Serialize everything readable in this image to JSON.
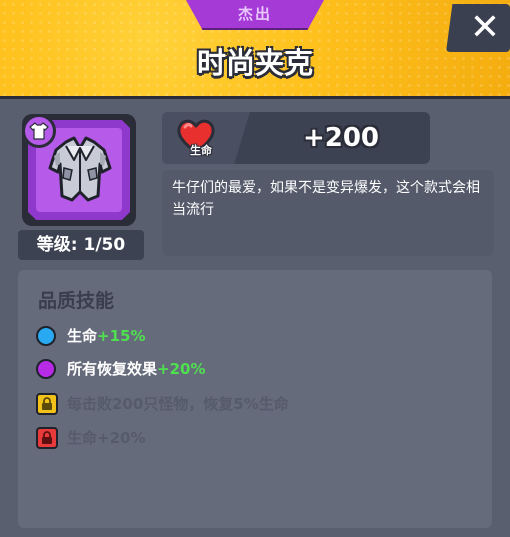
{
  "header": {
    "rarity": "杰出",
    "title": "时尚夹克",
    "close_symbol": "✕"
  },
  "item": {
    "icon": "jacket-armor",
    "slot_icon": "shirt-icon",
    "rarity_color": "#a53ad6",
    "level_text": "等级: 1/50"
  },
  "stat": {
    "icon": "heart-icon",
    "label": "生命",
    "value": "+200"
  },
  "description": "牛仔们的最爱，如果不是变异爆发，这个款式会相当流行",
  "skills": {
    "title": "品质技能",
    "items": [
      {
        "icon": "blue-circle",
        "color": "#29a9f2",
        "label": "生命",
        "bonus": "+15%",
        "locked": false
      },
      {
        "icon": "purple-circle",
        "color": "#b72be6",
        "label": "所有恢复效果",
        "bonus": "+20%",
        "locked": false
      },
      {
        "icon": "lock-icon",
        "color": "#f2c21a",
        "label": "每击败200只怪物，恢复5%生命",
        "bonus": "",
        "locked": true
      },
      {
        "icon": "lock-icon",
        "color": "#e83a3a",
        "label": "生命+20%",
        "bonus": "",
        "locked": true
      }
    ]
  }
}
